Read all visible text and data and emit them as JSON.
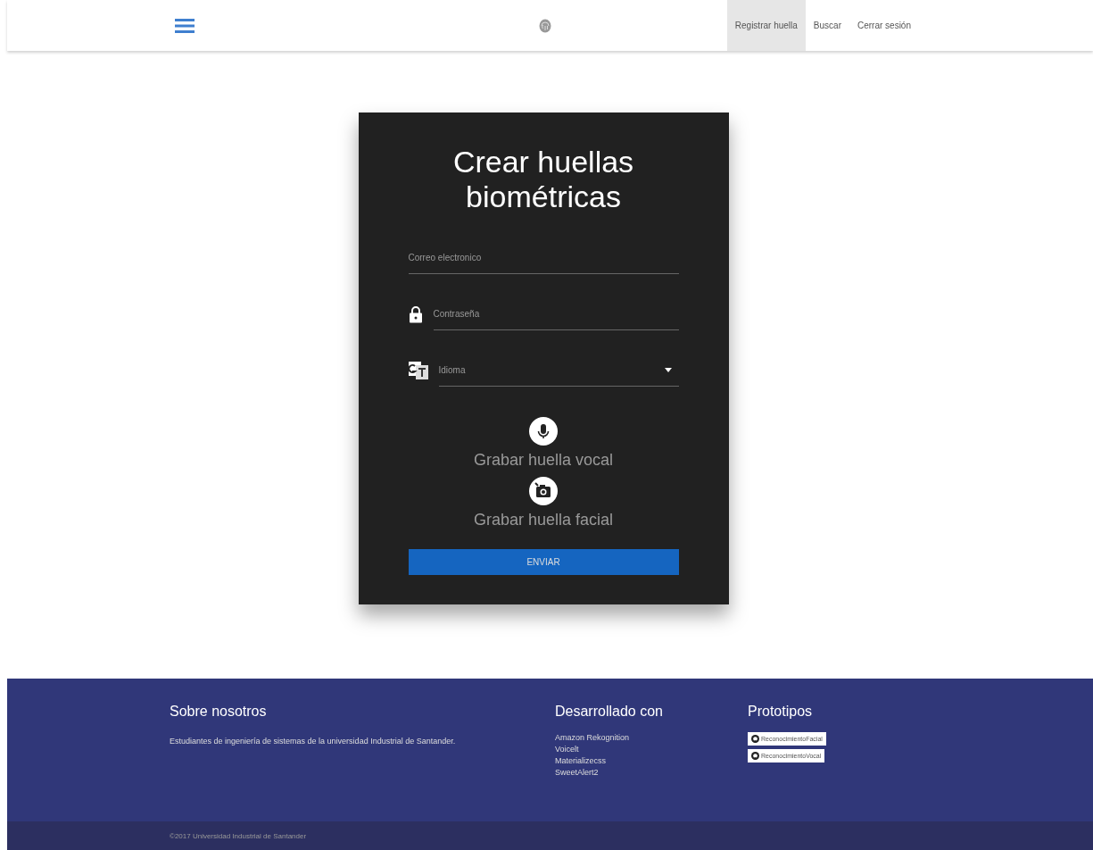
{
  "nav": {
    "items": [
      {
        "label": "Registrar huella",
        "selected": true
      },
      {
        "label": "Buscar",
        "selected": false
      },
      {
        "label": "Cerrar sesión",
        "selected": false
      }
    ]
  },
  "form": {
    "title": "Crear huellas biométricas",
    "fields": [
      {
        "kind": "text",
        "placeholder": "Correo electronico"
      },
      {
        "kind": "password",
        "placeholder": "Contraseña"
      },
      {
        "kind": "select",
        "placeholder": "Idioma"
      }
    ],
    "recorders": [
      {
        "kind": "mic",
        "label": "Grabar huella vocal"
      },
      {
        "kind": "camera",
        "label": "Grabar huella facial"
      }
    ],
    "submit": "ENVIAR"
  },
  "footer": {
    "about": {
      "title": "Sobre nosotros",
      "text": "Estudiantes de ingeniería de sistemas de la universidad Industrial de Santander."
    },
    "built_with": {
      "title": "Desarrollado con",
      "items": [
        "Amazon Rekognition",
        "Voicelt",
        "Materializecss",
        "SweetAlert2"
      ]
    },
    "prototypes": {
      "title": "Prototipos",
      "buttons": [
        "ReconocimientoFacial",
        "ReconocimientoVocal"
      ]
    },
    "copyright": "©2017 Universidad Industrial de Santander"
  }
}
